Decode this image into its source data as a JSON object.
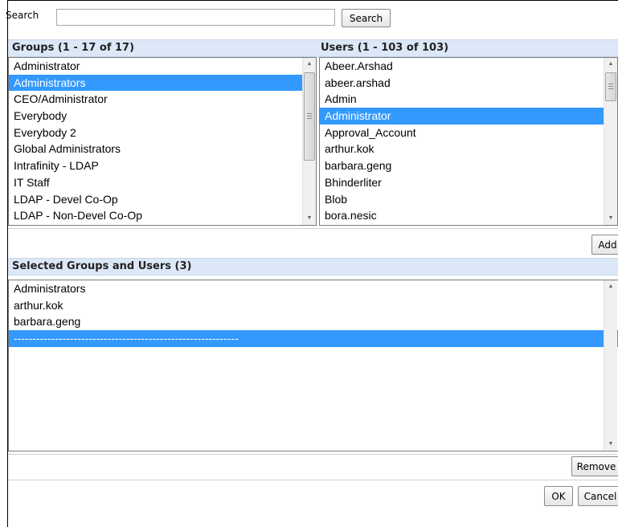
{
  "search": {
    "label": "Search",
    "value": "",
    "button": "Search"
  },
  "groups": {
    "header": "Groups (1 - 17 of 17)",
    "items": [
      "Administrator",
      "Administrators",
      "CEO/Administrator",
      "Everybody",
      "Everybody 2",
      "Global Administrators",
      "Intrafinity - LDAP",
      "IT Staff",
      "LDAP - Devel Co-Op",
      "LDAP - Non-Devel Co-Op"
    ],
    "selected_index": 1
  },
  "users": {
    "header": "Users (1 - 103 of 103)",
    "items": [
      "Abeer.Arshad",
      "abeer.arshad",
      "Admin",
      "Administrator",
      "Approval_Account",
      "arthur.kok",
      "barbara.geng",
      "Bhinderliter",
      "Blob",
      "bora.nesic"
    ],
    "selected_index": 3
  },
  "add_button": "Add",
  "selected": {
    "header": "Selected Groups and Users (3)",
    "items": [
      "Administrators",
      "arthur.kok",
      "barbara.geng",
      "------------------------------------------------------------"
    ],
    "selected_index": 3
  },
  "remove_button": "Remove",
  "ok_button": "OK",
  "cancel_button": "Cancel",
  "colors": {
    "selection": "#3399ff",
    "header_bg": "#dce8f7"
  }
}
